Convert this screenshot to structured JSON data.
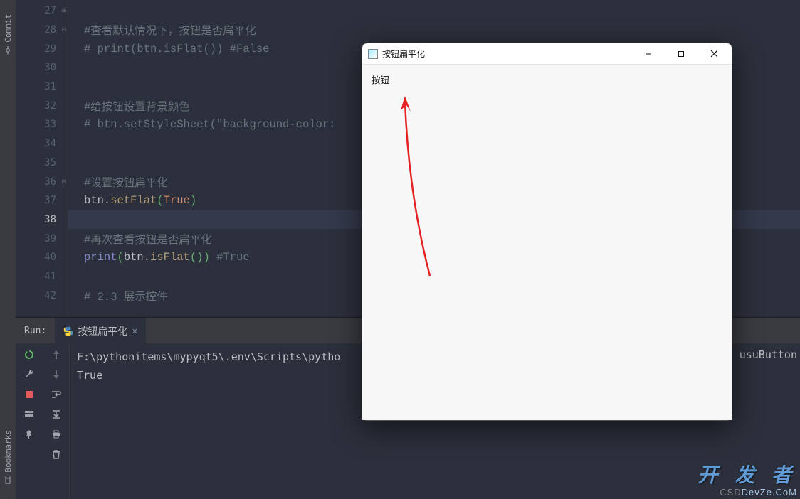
{
  "sidebar": {
    "commit_label": "Commit",
    "bookmarks_label": "Bookmarks"
  },
  "editor": {
    "lines": [
      {
        "no": 27,
        "tokens": [],
        "fold": "close"
      },
      {
        "no": 28,
        "tokens": [
          {
            "c": "cm",
            "t": "#查看默认情况下，按钮是否扁平化"
          }
        ],
        "fold": "open"
      },
      {
        "no": 29,
        "tokens": [
          {
            "c": "cm",
            "t": "# print(btn.isFlat()) #False"
          }
        ]
      },
      {
        "no": 30,
        "tokens": []
      },
      {
        "no": 31,
        "tokens": []
      },
      {
        "no": 32,
        "tokens": [
          {
            "c": "cm",
            "t": "#给按钮设置背景颜色"
          }
        ]
      },
      {
        "no": 33,
        "tokens": [
          {
            "c": "cm",
            "t": "# btn.setStyleSheet(\"background-color:"
          }
        ]
      },
      {
        "no": 34,
        "tokens": []
      },
      {
        "no": 35,
        "tokens": []
      },
      {
        "no": 36,
        "tokens": [
          {
            "c": "cm",
            "t": "#设置按钮扁平化"
          }
        ],
        "fold": "open"
      },
      {
        "no": 37,
        "tokens": [
          {
            "c": "obj",
            "t": "btn"
          },
          {
            "c": "punct",
            "t": "."
          },
          {
            "c": "fn",
            "t": "setFlat"
          },
          {
            "c": "par",
            "t": "("
          },
          {
            "c": "kw",
            "t": "True"
          },
          {
            "c": "par",
            "t": ")"
          }
        ]
      },
      {
        "no": 38,
        "tokens": [],
        "current": true,
        "hl": true
      },
      {
        "no": 39,
        "tokens": [
          {
            "c": "cm",
            "t": "#再次查看按钮是否扁平化"
          }
        ]
      },
      {
        "no": 40,
        "tokens": [
          {
            "c": "builtin",
            "t": "print"
          },
          {
            "c": "par",
            "t": "("
          },
          {
            "c": "obj",
            "t": "btn"
          },
          {
            "c": "punct",
            "t": "."
          },
          {
            "c": "fn",
            "t": "isFlat"
          },
          {
            "c": "par",
            "t": "()"
          },
          {
            "c": "par",
            "t": ")"
          },
          {
            "c": "obj",
            "t": " "
          },
          {
            "c": "cm",
            "t": "#True"
          }
        ]
      },
      {
        "no": 41,
        "tokens": []
      },
      {
        "no": 42,
        "tokens": [
          {
            "c": "cm",
            "t": "# 2.3 展示控件"
          }
        ]
      }
    ]
  },
  "run": {
    "label": "Run:",
    "tab_label": "按钮扁平化",
    "console": [
      "F:\\pythonitems\\mypyqt5\\.env\\Scripts\\pytho",
      "True"
    ],
    "console_right": "usuButton"
  },
  "window": {
    "title": "按钮扁平化",
    "button_label": "按钮"
  },
  "watermark": {
    "big": "开 发 者",
    "small_left": "CSD",
    "small_right": "DevZe.CoM"
  }
}
